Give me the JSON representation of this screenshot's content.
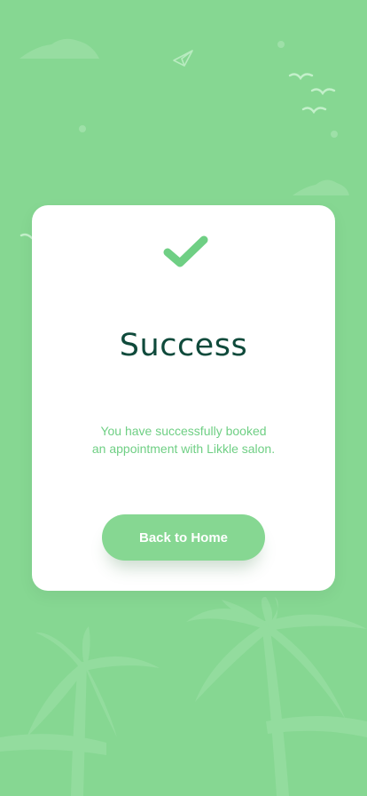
{
  "colors": {
    "background": "#86d792",
    "card": "#ffffff",
    "title": "#0f4a3b",
    "accent": "#6fcf84"
  },
  "dialog": {
    "icon": "checkmark-icon",
    "title": "Success",
    "message_line1": "You have successfully booked",
    "message_line2": "an appointment with Likkle salon.",
    "button_label": "Back to Home"
  },
  "decorations": [
    "cloud-icon",
    "paper-plane-icon",
    "bird-icon",
    "palm-tree-icon"
  ]
}
